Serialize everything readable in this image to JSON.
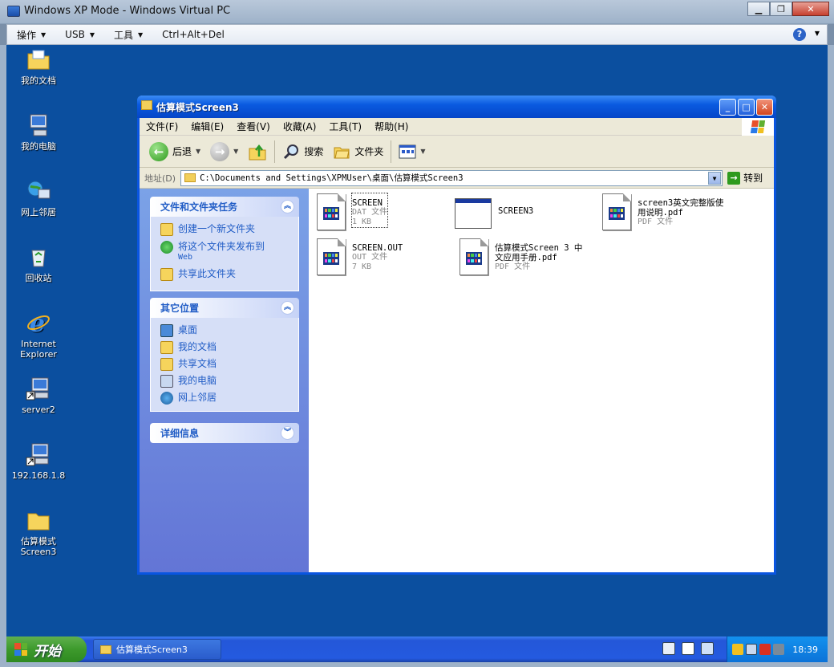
{
  "host": {
    "title": "Windows XP Mode - Windows Virtual PC",
    "menu": [
      {
        "label": "操作"
      },
      {
        "label": "USB"
      },
      {
        "label": "工具"
      },
      {
        "label": "Ctrl+Alt+Del"
      }
    ],
    "help_icon": "?"
  },
  "desktop_icons": [
    {
      "label": "我的文档",
      "icon": "documents-folder-icon"
    },
    {
      "label": "我的电脑",
      "icon": "computer-icon"
    },
    {
      "label": "网上邻居",
      "icon": "network-icon"
    },
    {
      "label": "回收站",
      "icon": "recycle-bin-icon"
    },
    {
      "label": "Internet Explorer",
      "icon": "ie-icon"
    },
    {
      "label": "server2",
      "icon": "shortcut-computer-icon"
    },
    {
      "label": "192.168.1.8",
      "icon": "shortcut-computer-icon"
    },
    {
      "label": "估算模式Screen3",
      "icon": "folder-icon"
    }
  ],
  "explorer": {
    "title": "估算模式Screen3",
    "menu": [
      "文件(F)",
      "编辑(E)",
      "查看(V)",
      "收藏(A)",
      "工具(T)",
      "帮助(H)"
    ],
    "toolbar": {
      "back": "后退",
      "search": "搜索",
      "folders": "文件夹"
    },
    "address": {
      "label": "地址(D)",
      "path": "C:\\Documents and Settings\\XPMUser\\桌面\\估算模式Screen3",
      "go": "转到"
    },
    "panels": [
      {
        "title": "文件和文件夹任务",
        "items": [
          {
            "label": "创建一个新文件夹",
            "sub": ""
          },
          {
            "label": "将这个文件夹发布到",
            "sub": "Web"
          },
          {
            "label": "共享此文件夹",
            "sub": ""
          }
        ]
      },
      {
        "title": "其它位置",
        "items": [
          {
            "label": "桌面"
          },
          {
            "label": "我的文档"
          },
          {
            "label": "共享文档"
          },
          {
            "label": "我的电脑"
          },
          {
            "label": "网上邻居"
          }
        ]
      },
      {
        "title": "详细信息"
      }
    ],
    "files": [
      {
        "name": "SCREEN",
        "type": "DAT 文件",
        "size": "1 KB"
      },
      {
        "name": "SCREEN3",
        "type": "",
        "size": ""
      },
      {
        "name": "screen3英文完整版使用说明.pdf",
        "line1": "screen3英文完整版使",
        "line2": "用说明.pdf",
        "type": "PDF 文件"
      },
      {
        "name": "SCREEN.OUT",
        "type": "OUT 文件",
        "size": "7 KB"
      },
      {
        "name": "估算模式Screen 3 中文应用手册.pdf",
        "line1": "估算模式Screen 3 中",
        "line2": "文应用手册.pdf",
        "type": "PDF 文件"
      }
    ]
  },
  "taskbar": {
    "start": "开始",
    "task": "估算模式Screen3",
    "clock": "18:39"
  },
  "colors": {
    "desktop": "#0b4f9f",
    "xp_blue": "#0a55e0",
    "task_link": "#215dc6"
  }
}
